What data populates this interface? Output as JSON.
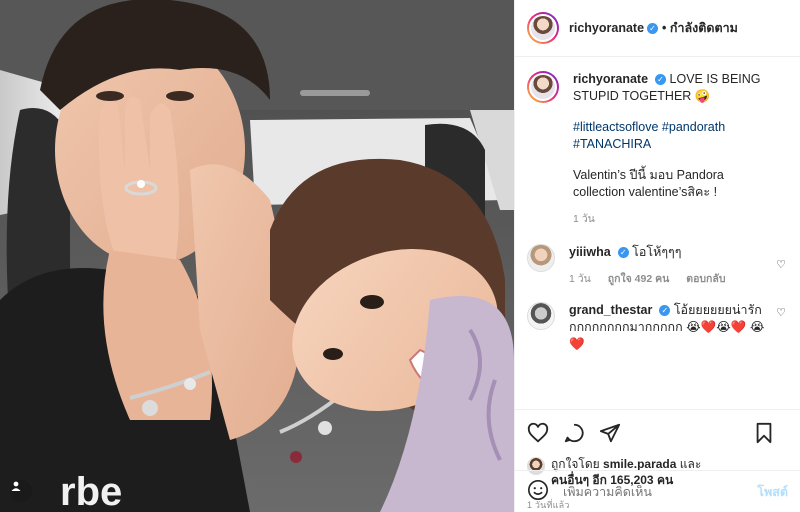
{
  "post": {
    "author": "richyoranate",
    "follow_label": "• กำลังติดตาม",
    "caption_text": "LOVE IS BEING STUPID TOGETHER",
    "caption_emoji": "🤪",
    "hashtags": "#littleactsoflove #pandorath #TANACHIRA",
    "caption_line2": "Valentin’s ปีนี้ มอบ Pandora collection valentine’sสิคะ !",
    "caption_time": "1 วัน"
  },
  "comments": [
    {
      "user": "yiiiwha",
      "text": "โอโห้ๆๆๆ",
      "time": "1 วัน",
      "likes": "ถูกใจ 492 คน",
      "reply": "ตอบกลับ"
    },
    {
      "user": "grand_thestar",
      "text": "โอ้ยยยยยยน่ารักกกกกกกกกมากกกกก 😭❤️😭❤️ 😭❤️"
    }
  ],
  "likes": {
    "prefix": "ถูกใจโดย",
    "first_user": "smile.parada",
    "and": "และ",
    "others": "คนอื่นๆ อีก 165,203 คน"
  },
  "posted_ago": "1 วันที่แล้ว",
  "add_comment": {
    "placeholder": "เพิ่มความคิดเห็น",
    "post_label": "โพสต์"
  },
  "icons": {
    "verified": "verified-badge",
    "heart": "heart-icon",
    "comment": "comment-icon",
    "share": "share-icon",
    "bookmark": "bookmark-icon",
    "emoji": "emoji-icon",
    "more": "more-options-icon",
    "tag": "user-tag-icon"
  },
  "colors": {
    "verified_blue": "#3897f0",
    "hashtag": "#00376b",
    "post_disabled": "#b2dffc",
    "meta_gray": "#8e8e8e"
  }
}
